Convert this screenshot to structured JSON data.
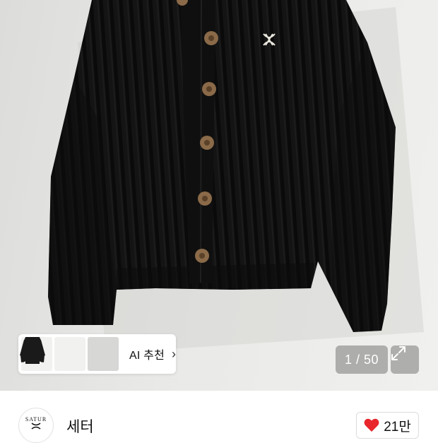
{
  "product_image": {
    "alt_icon": "black-ribbed-cardigan-photo",
    "background_color": "#e6e6e4",
    "garment_color": "#111111",
    "button_color": "#8a6a48"
  },
  "ai_recommend": {
    "label": "AI 추천",
    "chevron_icon": "chevron-right-icon",
    "thumbnails": [
      "sweater-thumbnail-1",
      "sweater-thumbnail-2",
      "sweater-thumbnail-3"
    ]
  },
  "gallery": {
    "counter": "1 / 50",
    "expand_icon": "expand-icon"
  },
  "brand": {
    "logo_text": "SATUR",
    "name": "세터"
  },
  "like": {
    "icon": "heart-icon",
    "count": "21만",
    "icon_color": "#e8262c"
  }
}
